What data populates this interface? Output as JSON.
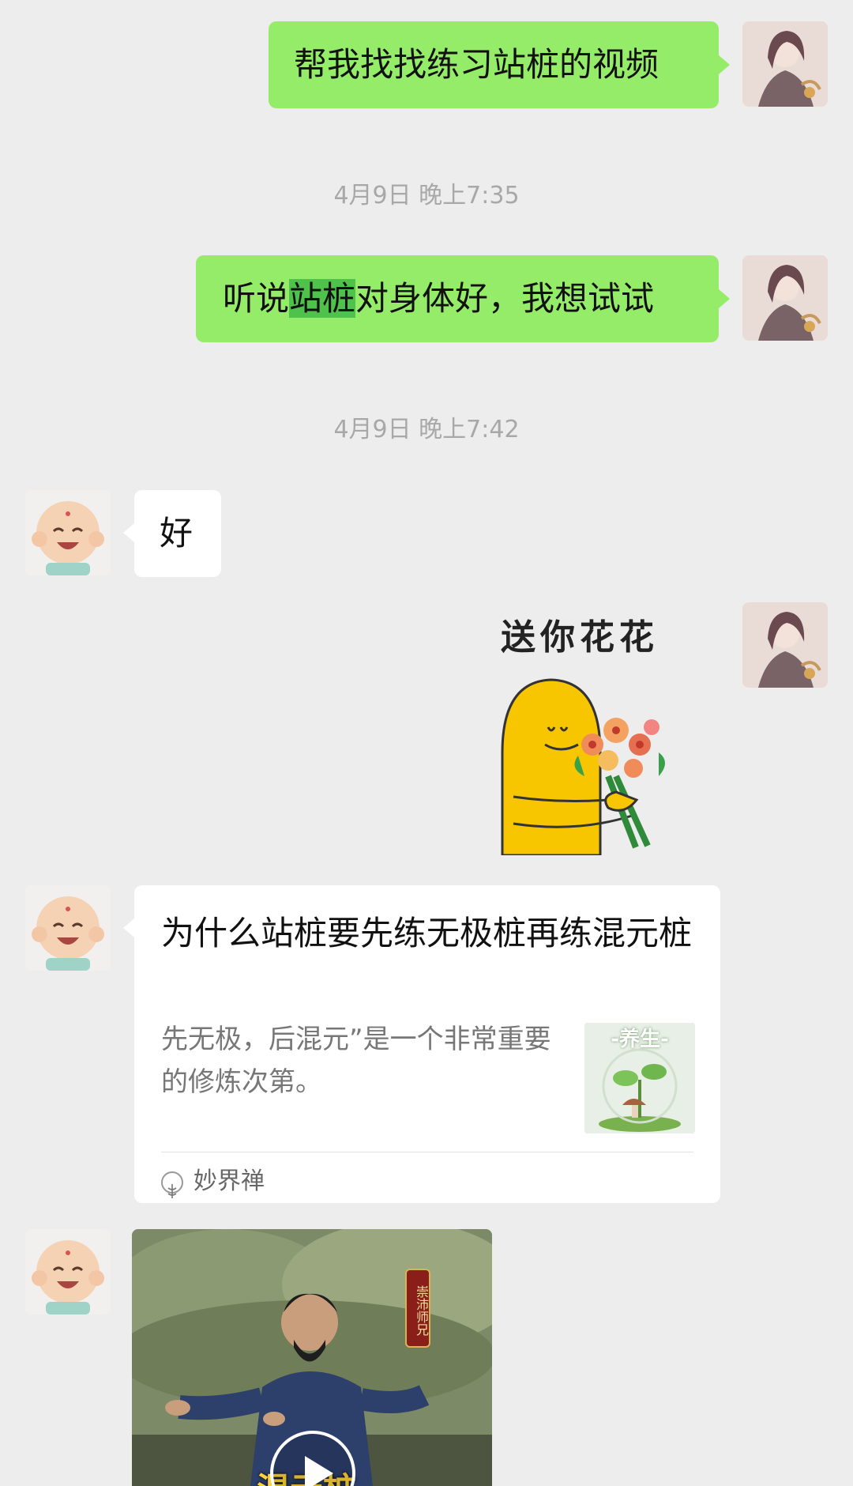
{
  "messages": {
    "m1_text": "帮我找找练习站桩的视频",
    "time1": "4月9日 晚上7:35",
    "m2_before": "听说",
    "m2_highlight": "站桩",
    "m2_after": "对身体好，我想试试",
    "time2": "4月9日 晚上7:42",
    "m3_text": "好",
    "sticker_caption": "送你花花",
    "card": {
      "title": "为什么站桩要先练无极桩再练混元桩",
      "description": "先无极，后混元”是一个非常重要的修炼次第。",
      "thumb_label": "-养生-",
      "source": "妙界禅"
    },
    "video": {
      "badge": "崇沛师兄",
      "caption": "混元桩"
    }
  },
  "colors": {
    "background": "#ededed",
    "sent_bubble": "#95ec69",
    "received_bubble": "#ffffff",
    "highlight": "#4fc24b"
  }
}
